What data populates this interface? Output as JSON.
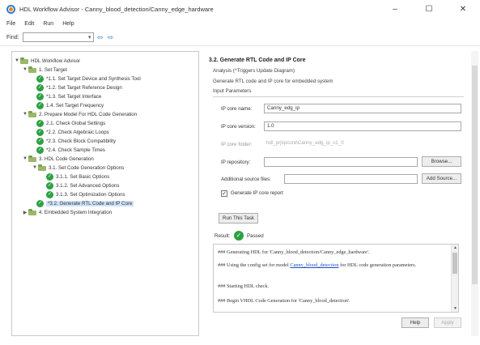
{
  "window": {
    "title": "HDL Workflow Advisor - Canny_blood_detection/Canny_edge_hardware",
    "minimize": "–",
    "maximize": "☐",
    "close": "✕"
  },
  "menu": [
    "File",
    "Edit",
    "Run",
    "Help"
  ],
  "find": {
    "label": "Find:",
    "value": ""
  },
  "tree": [
    {
      "label": "HDL Workflow Advisor",
      "toggle": "▼",
      "icon": "folder-icon"
    },
    {
      "label": "1. Set Target",
      "toggle": "▼",
      "icon": "folder-icon"
    },
    {
      "label": "*1.1. Set Target Device and Synthesis Tool",
      "icon": "check-icon"
    },
    {
      "label": "*1.2. Set Target Reference Design",
      "icon": "check-icon"
    },
    {
      "label": "*1.3. Set Target Interface",
      "icon": "check-icon"
    },
    {
      "label": "1.4. Set Target Frequency",
      "icon": "check-icon"
    },
    {
      "label": "2. Prepare Model For HDL Code Generation",
      "toggle": "▼",
      "icon": "folder-icon"
    },
    {
      "label": "2.1. Check Global Settings",
      "icon": "check-icon"
    },
    {
      "label": "*2.2. Check Algebraic Loops",
      "icon": "check-icon"
    },
    {
      "label": "*2.3. Check Block Compatibility",
      "icon": "check-icon"
    },
    {
      "label": "*2.4. Check Sample Times",
      "icon": "check-icon"
    },
    {
      "label": "3. HDL Code Generation",
      "toggle": "▼",
      "icon": "folder-icon"
    },
    {
      "label": "3.1. Set Code Generation Options",
      "toggle": "▼",
      "icon": "folder-icon"
    },
    {
      "label": "3.1.1. Set Basic Options",
      "icon": "check-icon"
    },
    {
      "label": "3.1.2. Set Advanced Options",
      "icon": "check-icon"
    },
    {
      "label": "3.1.3. Set Optimization Options",
      "icon": "check-icon"
    },
    {
      "label": "*3.2. Generate RTL Code and IP Core",
      "icon": "check-icon",
      "selected": true
    },
    {
      "label": "4. Embedded System Integration",
      "toggle": "▶",
      "icon": "folder-icon"
    }
  ],
  "panel": {
    "title": "3.2. Generate RTL Code and IP Core",
    "analysis": "Analysis (^Triggers Update Diagram)",
    "description": "Generate RTL code and IP core for embedded system",
    "input_header": "Input Parameters",
    "ip_core_name_label": "IP core name:",
    "ip_core_name_value": "Canny_edg_ip",
    "ip_core_version_label": "IP core version:",
    "ip_core_version_value": "1.0",
    "ip_core_folder_label": "IP core folder:",
    "ip_core_folder_value": "hdl_prj\\ipcore\\Canny_edg_ip_v1_0",
    "ip_repository_label": "IP repository:",
    "ip_repository_value": "",
    "browse_label": "Browse...",
    "additional_files_label": "Additional source files:",
    "additional_files_value": "",
    "add_source_label": "Add Source...",
    "generate_report_label": "Generate IP core report",
    "generate_report_checked": "✓",
    "run_button_label": "Run This Task",
    "result_label": "Result:",
    "result_status": "Passed",
    "result_icon": "✓"
  },
  "log": {
    "line1": "### Generating HDL for 'Canny_blood_detection/Canny_edge_hardware'.",
    "line2_pre": "### Using the config set for model ",
    "line2_link": "Canny_blood_detection",
    "line2_post": " for HDL code generation parameters.",
    "line3": "### Starting HDL check.",
    "line4": "### Begin VHDL Code Generation for 'Canny_blood_detection'."
  },
  "footer": {
    "help_label": "Help",
    "apply_label": "Apply"
  },
  "colors": {
    "check_green": "#2ea043",
    "selection": "#cfe3fb",
    "link": "#1a4fc0"
  }
}
